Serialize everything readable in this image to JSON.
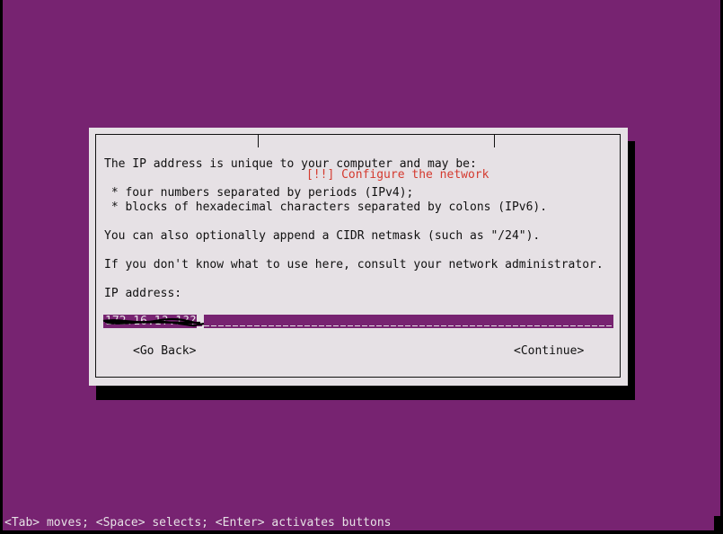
{
  "dialog": {
    "title": "[!!] Configure the network",
    "lines": {
      "intro": "The IP address is unique to your computer and may be:",
      "bullet_ipv4": " * four numbers separated by periods (IPv4);",
      "bullet_ipv6": " * blocks of hexadecimal characters separated by colons (IPv6).",
      "cidr": "You can also optionally append a CIDR netmask (such as \"/24\").",
      "help": "If you don't know what to use here, consult your network administrator."
    },
    "field": {
      "label": "IP address:",
      "value": "172.16.1?.1??",
      "value_redacted": true
    },
    "buttons": {
      "back": "<Go Back>",
      "continue": "<Continue>"
    }
  },
  "status_bar": {
    "hint": "<Tab> moves; <Space> selects; <Enter> activates buttons"
  },
  "colors": {
    "background": "#772371",
    "dialog_bg": "#e6e1e5",
    "title": "#d43a2f",
    "shadow": "#000000",
    "field_bg": "#772371"
  }
}
